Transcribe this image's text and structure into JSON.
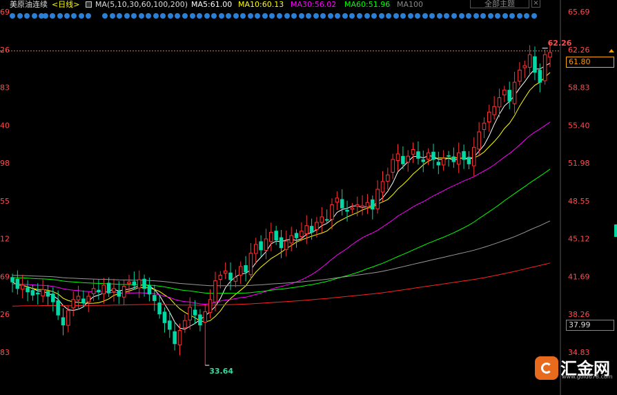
{
  "header": {
    "symbol": "美原油连续",
    "period": "<日线>",
    "ma_params": "MA(5,10,30,60,100,200)",
    "ma_values": [
      {
        "label": "MA5:61.00",
        "color": "#ffffff"
      },
      {
        "label": "MA10:60.13",
        "color": "#ffff00"
      },
      {
        "label": "MA30:56.02",
        "color": "#ff00ff"
      },
      {
        "label": "MA60:51.96",
        "color": "#00ff00"
      },
      {
        "label": "MA100",
        "color": "#888888"
      }
    ],
    "theme_button": "全部主题"
  },
  "price_axis": {
    "right_labels": [
      "65.69",
      "62.26",
      "58.83",
      "55.40",
      "51.98",
      "48.55",
      "45.12",
      "41.69",
      "38.26",
      "34.83"
    ],
    "left_labels": [
      "69",
      "26",
      "83",
      "40",
      "98",
      "55",
      "12",
      "69",
      "26",
      "83"
    ],
    "current_price_box": "61.80",
    "lower_box": "37.99"
  },
  "annotations": {
    "high": "62.26",
    "low": "33.64"
  },
  "logo": {
    "name": "汇金网",
    "url": "www.gold678.com"
  },
  "colors": {
    "up": "#ff3333",
    "down": "#00d9a6",
    "axis_text": "#ff4d4d",
    "background": "#000000"
  },
  "chart_data": {
    "type": "candlestick",
    "y_axis": {
      "ticks": [
        65.69,
        62.26,
        58.83,
        55.4,
        51.98,
        48.55,
        45.12,
        41.69,
        38.26,
        34.83
      ],
      "range": [
        33.0,
        66.5
      ]
    },
    "candles_note": "approximate OHLC read from image, oldest to newest",
    "closes": [
      41.2,
      40.6,
      40.9,
      40.3,
      40.0,
      40.1,
      40.5,
      39.9,
      39.4,
      38.2,
      37.3,
      38.6,
      39.6,
      39.9,
      39.3,
      39.9,
      40.6,
      40.3,
      40.9,
      40.2,
      40.6,
      39.9,
      40.8,
      41.2,
      40.9,
      41.4,
      40.6,
      40.1,
      39.5,
      38.3,
      37.5,
      36.9,
      35.6,
      36.8,
      37.7,
      38.9,
      38.2,
      37.3,
      38.5,
      39.6,
      41.3,
      41.8,
      42.2,
      41.4,
      41.6,
      42.6,
      42.1,
      43.8,
      44.6,
      44.1,
      45.1,
      45.7,
      45.0,
      44.3,
      44.9,
      45.4,
      45.2,
      45.8,
      46.3,
      45.7,
      46.6,
      47.1,
      46.8,
      48.2,
      48.8,
      47.9,
      47.6,
      47.9,
      48.2,
      48.1,
      48.4,
      47.8,
      49.6,
      50.3,
      50.9,
      52.3,
      52.8,
      51.9,
      52.6,
      53.2,
      52.4,
      52.1,
      52.9,
      52.3,
      51.8,
      52.4,
      52.6,
      52.1,
      52.9,
      52.3,
      51.9,
      53.4,
      54.8,
      55.6,
      56.6,
      57.1,
      57.9,
      58.6,
      57.6,
      59.3,
      60.4,
      60.8,
      61.8,
      60.2,
      59.3,
      61.8,
      62.0
    ],
    "low": {
      "value": 33.64,
      "index": 38
    },
    "high": {
      "value": 62.26,
      "index": 105
    },
    "ma_series": [
      {
        "name": "MA5",
        "color": "#ffffff"
      },
      {
        "name": "MA10",
        "color": "#ffff00"
      },
      {
        "name": "MA30",
        "color": "#ff00ff"
      },
      {
        "name": "MA60",
        "color": "#00ff00"
      },
      {
        "name": "MA100",
        "color": "#999999"
      },
      {
        "name": "MA200",
        "color": "#ff2020"
      }
    ]
  }
}
